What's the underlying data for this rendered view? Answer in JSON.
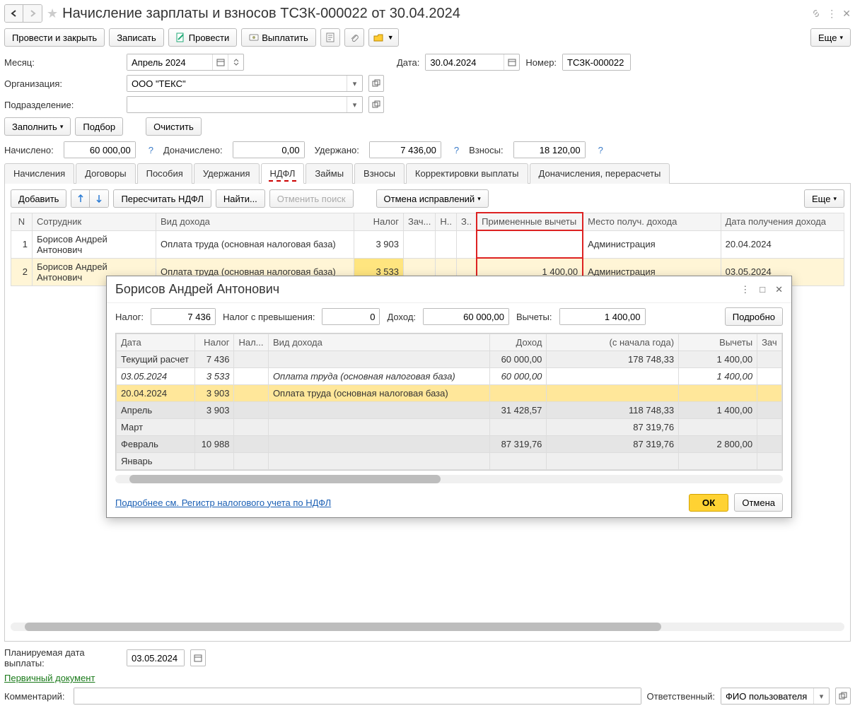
{
  "header": {
    "title": "Начисление зарплаты и взносов ТСЗК-000022 от 30.04.2024"
  },
  "toolbar": {
    "post_close": "Провести и закрыть",
    "save": "Записать",
    "post": "Провести",
    "pay": "Выплатить",
    "more": "Еще"
  },
  "form": {
    "month_label": "Месяц:",
    "month_value": "Апрель 2024",
    "date_label": "Дата:",
    "date_value": "30.04.2024",
    "number_label": "Номер:",
    "number_value": "ТСЗК-000022",
    "org_label": "Организация:",
    "org_value": "ООО \"ТЕКС\"",
    "dept_label": "Подразделение:",
    "dept_value": "",
    "fill": "Заполнить",
    "pick": "Подбор",
    "clear": "Очистить"
  },
  "totals": {
    "accrued_label": "Начислено:",
    "accrued": "60 000,00",
    "add_accrued_label": "Доначислено:",
    "add_accrued": "0,00",
    "withheld_label": "Удержано:",
    "withheld": "7 436,00",
    "contrib_label": "Взносы:",
    "contrib": "18 120,00"
  },
  "tabs": {
    "accruals": "Начисления",
    "contracts": "Договоры",
    "benefits": "Пособия",
    "deductions": "Удержания",
    "ndfl": "НДФЛ",
    "loans": "Займы",
    "contribs": "Взносы",
    "corrections": "Корректировки выплаты",
    "addl": "Доначисления, перерасчеты"
  },
  "ndfl_tb": {
    "add": "Добавить",
    "recalc": "Пересчитать НДФЛ",
    "find": "Найти...",
    "cancel_search": "Отменить поиск",
    "cancel_fixes": "Отмена исправлений",
    "more": "Еще"
  },
  "ndfl_table": {
    "headers": {
      "n": "N",
      "employee": "Сотрудник",
      "income_type": "Вид дохода",
      "tax": "Налог",
      "zach": "Зач...",
      "n2": "Н..",
      "z": "З..",
      "applied_deductions": "Примененные вычеты",
      "income_place": "Место получ. дохода",
      "income_date": "Дата получения дохода"
    },
    "rows": [
      {
        "n": "1",
        "employee": "Борисов Андрей Антонович",
        "income_type": "Оплата труда (основная налоговая база)",
        "tax": "3 903",
        "deductions": "",
        "place": "Администрация",
        "date": "20.04.2024"
      },
      {
        "n": "2",
        "employee": "Борисов Андрей Антонович",
        "income_type": "Оплата труда (основная налоговая база)",
        "tax": "3 533",
        "deductions": "1 400,00",
        "place": "Администрация",
        "date": "03.05.2024"
      }
    ]
  },
  "popup": {
    "title": "Борисов Андрей Антонович",
    "tax_label": "Налог:",
    "tax": "7 436",
    "excess_label": "Налог с превышения:",
    "excess": "0",
    "income_label": "Доход:",
    "income": "60 000,00",
    "deductions_label": "Вычеты:",
    "deductions": "1 400,00",
    "details": "Подробно",
    "headers": {
      "date": "Дата",
      "tax": "Налог",
      "tax2": "Нал...",
      "income_type": "Вид дохода",
      "income": "Доход",
      "ytd": "(с начала года)",
      "deductions": "Вычеты",
      "zach": "Зач"
    },
    "rows": [
      {
        "date": "Текущий расчет",
        "tax": "7 436",
        "income_type": "",
        "income": "60 000,00",
        "ytd": "178 748,33",
        "deductions": "1 400,00",
        "cls": "gray-row"
      },
      {
        "date": "03.05.2024",
        "tax": "3 533",
        "income_type": "Оплата труда (основная налоговая база)",
        "income": "60 000,00",
        "ytd": "",
        "deductions": "1 400,00",
        "cls": "italic"
      },
      {
        "date": "20.04.2024",
        "tax": "3 903",
        "income_type": "Оплата труда (основная налоговая база)",
        "income": "",
        "ytd": "",
        "deductions": "",
        "cls": "sel-row"
      },
      {
        "date": "Апрель",
        "tax": "3 903",
        "income_type": "",
        "income": "31 428,57",
        "ytd": "118 748,33",
        "deductions": "1 400,00",
        "cls": "gray-row2"
      },
      {
        "date": "Март",
        "tax": "",
        "income_type": "",
        "income": "",
        "ytd": "87 319,76",
        "deductions": "",
        "cls": "gray-row"
      },
      {
        "date": "Февраль",
        "tax": "10 988",
        "income_type": "",
        "income": "87 319,76",
        "ytd": "87 319,76",
        "deductions": "2 800,00",
        "cls": "gray-row2"
      },
      {
        "date": "Январь",
        "tax": "",
        "income_type": "",
        "income": "",
        "ytd": "",
        "deductions": "",
        "cls": "gray-row"
      }
    ],
    "link": "Подробнее см. Регистр налогового учета по НДФЛ",
    "ok": "ОК",
    "cancel": "Отмена"
  },
  "footer": {
    "planned_date_label": "Планируемая дата выплаты:",
    "planned_date": "03.05.2024",
    "primary_doc": "Первичный документ",
    "comment_label": "Комментарий:",
    "responsible_label": "Ответственный:",
    "responsible": "ФИО пользователя"
  }
}
